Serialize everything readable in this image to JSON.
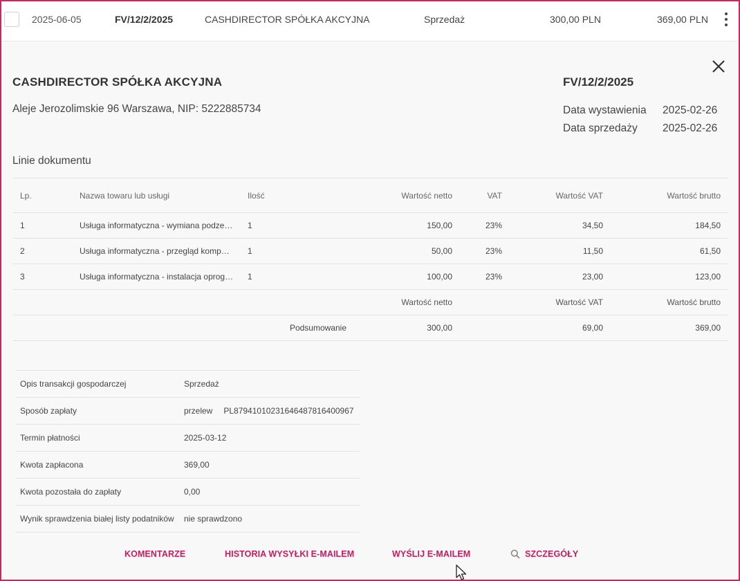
{
  "invoice_row": {
    "date": "2025-06-05",
    "number": "FV/12/2/2025",
    "contractor": "CASHDIRECTOR SPÓŁKA AKCYJNA",
    "type": "Sprzedaż",
    "net": "300,00 PLN",
    "gross": "369,00 PLN"
  },
  "detail": {
    "company_name": "CASHDIRECTOR SPÓŁKA AKCYJNA",
    "company_address": "Aleje Jerozolimskie 96 Warszawa, NIP: 5222885734",
    "document_number": "FV/12/2/2025",
    "issue_date_label": "Data wystawienia",
    "issue_date": "2025-02-26",
    "sale_date_label": "Data sprzedaży",
    "sale_date": "2025-02-26",
    "lines_title": "Linie dokumentu"
  },
  "lines_table": {
    "headers": {
      "lp": "Lp.",
      "name": "Nazwa towaru lub usługi",
      "qty": "Ilość",
      "net": "Wartość netto",
      "vat": "VAT",
      "vat_value": "Wartość VAT",
      "gross": "Wartość brutto"
    },
    "rows": [
      {
        "lp": "1",
        "name": "Usługa informatyczna - wymiana podze…",
        "qty": "1",
        "net": "150,00",
        "vat": "23%",
        "vat_value": "34,50",
        "gross": "184,50"
      },
      {
        "lp": "2",
        "name": "Usługa informatyczna - przegląd kompu…",
        "qty": "1",
        "net": "50,00",
        "vat": "23%",
        "vat_value": "11,50",
        "gross": "61,50"
      },
      {
        "lp": "3",
        "name": "Usługa informatyczna - instalacja oprog…",
        "qty": "1",
        "net": "100,00",
        "vat": "23%",
        "vat_value": "23,00",
        "gross": "123,00"
      }
    ],
    "summary_headers": {
      "net": "Wartość netto",
      "vat_value": "Wartość VAT",
      "gross": "Wartość brutto"
    },
    "summary": {
      "label": "Podsumowanie",
      "net": "300,00",
      "vat_value": "69,00",
      "gross": "369,00"
    }
  },
  "info": [
    {
      "label": "Opis transakcji gospodarczej",
      "value": "Sprzedaż"
    },
    {
      "label": "Sposób zapłaty",
      "value": "przelew",
      "extra": "PL87941010231646487816400967"
    },
    {
      "label": "Termin płatności",
      "value": "2025-03-12"
    },
    {
      "label": "Kwota zapłacona",
      "value": "369,00"
    },
    {
      "label": "Kwota pozostała do zapłaty",
      "value": "0,00"
    },
    {
      "label": "Wynik sprawdzenia białej listy podatników",
      "value": "nie sprawdzono"
    }
  ],
  "actions": {
    "comments": "KOMENTARZE",
    "email_history": "HISTORIA WYSYŁKI E-MAILEM",
    "send_email": "WYŚLIJ E-MAILEM",
    "details": "SZCZEGÓŁY"
  },
  "colors": {
    "accent": "#c41d5d",
    "frame": "#d0245e",
    "panel_bg": "#f8f8f8"
  },
  "icons": {
    "close": "close-icon",
    "menu": "more-vertical-icon",
    "details": "search-icon",
    "pointer": "mouse-pointer-icon"
  }
}
